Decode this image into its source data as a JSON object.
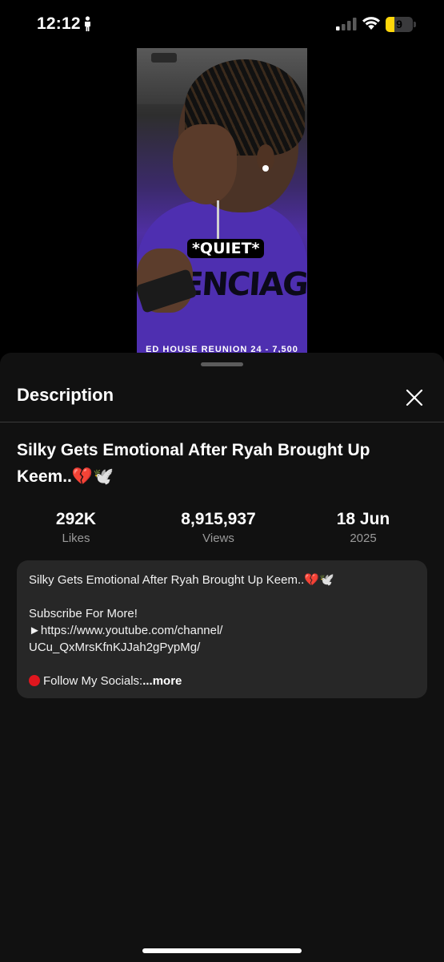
{
  "status_bar": {
    "time": "12:12",
    "battery_level": "9",
    "battery_fraction": 0.32,
    "battery_color": "#ffd60a"
  },
  "video": {
    "caption": "*QUIET*",
    "logo_text": "ENCIAG",
    "overlay_text": "ED HOUSE REUNION 24 - 7,500"
  },
  "sheet": {
    "title": "Description",
    "close_icon": "close-icon"
  },
  "video_info": {
    "title": "Silky Gets Emotional After Ryah Brought Up Keem..💔🕊️",
    "stats": [
      {
        "value": "292K",
        "label": "Likes"
      },
      {
        "value": "8,915,937",
        "label": "Views"
      },
      {
        "value": "18 Jun",
        "label": "2025"
      }
    ]
  },
  "description": {
    "line1": "Silky Gets Emotional After Ryah Brought Up Keem..💔🕊️",
    "line2": "Subscribe For More!",
    "line3": "►https://www.youtube.com/channel/",
    "line4": "UCu_QxMrsKfnKJJah2gPypMg/",
    "line5": "Follow My Socials:",
    "more_label": "...more"
  },
  "colors": {
    "sheet_bg": "#111111",
    "box_bg": "#272727",
    "muted_text": "#9a9a9a"
  }
}
